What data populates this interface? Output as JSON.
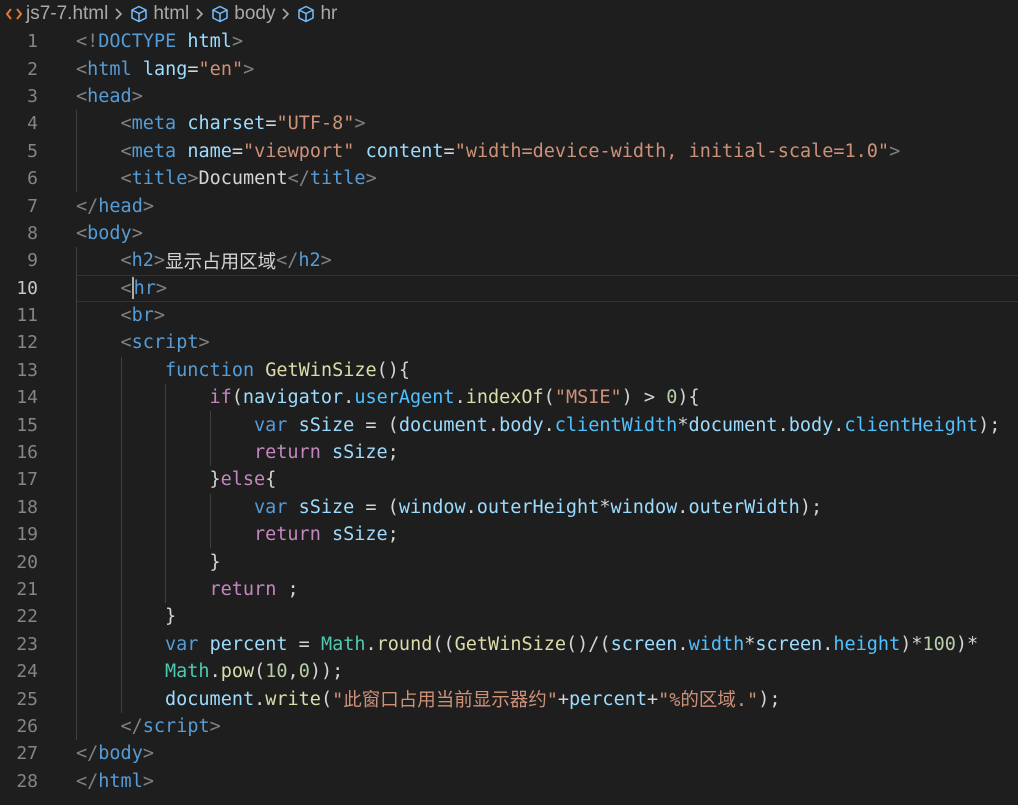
{
  "breadcrumb": {
    "file": "js7-7.html",
    "items": [
      "html",
      "body",
      "hr"
    ]
  },
  "colors": {
    "background": "#1e1e1e",
    "tag": "#569cd6",
    "string": "#ce9178",
    "attribute": "#9cdcfe",
    "function": "#dcdcaa",
    "control": "#c586c0",
    "class": "#4ec9b0",
    "number": "#b5cea8"
  },
  "editor": {
    "current_line": 10,
    "lines": [
      {
        "n": "1",
        "tokens": [
          [
            "p",
            "<!"
          ],
          [
            "t",
            "DOCTYPE"
          ],
          [
            "o",
            " "
          ],
          [
            "a",
            "html"
          ],
          [
            "p",
            ">"
          ]
        ]
      },
      {
        "n": "2",
        "tokens": [
          [
            "p",
            "<"
          ],
          [
            "t",
            "html"
          ],
          [
            "o",
            " "
          ],
          [
            "a",
            "lang"
          ],
          [
            "o",
            "="
          ],
          [
            "s",
            "\"en\""
          ],
          [
            "p",
            ">"
          ]
        ]
      },
      {
        "n": "3",
        "tokens": [
          [
            "p",
            "<"
          ],
          [
            "t",
            "head"
          ],
          [
            "p",
            ">"
          ]
        ]
      },
      {
        "n": "4",
        "indent": 1,
        "tokens": [
          [
            "p",
            "<"
          ],
          [
            "t",
            "meta"
          ],
          [
            "o",
            " "
          ],
          [
            "a",
            "charset"
          ],
          [
            "o",
            "="
          ],
          [
            "s",
            "\"UTF-8\""
          ],
          [
            "p",
            ">"
          ]
        ]
      },
      {
        "n": "5",
        "indent": 1,
        "tokens": [
          [
            "p",
            "<"
          ],
          [
            "t",
            "meta"
          ],
          [
            "o",
            " "
          ],
          [
            "a",
            "name"
          ],
          [
            "o",
            "="
          ],
          [
            "s",
            "\"viewport\""
          ],
          [
            "o",
            " "
          ],
          [
            "a",
            "content"
          ],
          [
            "o",
            "="
          ],
          [
            "s",
            "\"width=device-width, initial-scale=1.0\""
          ],
          [
            "p",
            ">"
          ]
        ]
      },
      {
        "n": "6",
        "indent": 1,
        "tokens": [
          [
            "p",
            "<"
          ],
          [
            "t",
            "title"
          ],
          [
            "p",
            ">"
          ],
          [
            "o",
            "Document"
          ],
          [
            "p",
            "</"
          ],
          [
            "t",
            "title"
          ],
          [
            "p",
            ">"
          ]
        ]
      },
      {
        "n": "7",
        "tokens": [
          [
            "p",
            "</"
          ],
          [
            "t",
            "head"
          ],
          [
            "p",
            ">"
          ]
        ]
      },
      {
        "n": "8",
        "tokens": [
          [
            "p",
            "<"
          ],
          [
            "t",
            "body"
          ],
          [
            "p",
            ">"
          ]
        ]
      },
      {
        "n": "9",
        "indent": 1,
        "tokens": [
          [
            "p",
            "<"
          ],
          [
            "t",
            "h2"
          ],
          [
            "p",
            ">"
          ],
          [
            "o",
            "显示占用区域"
          ],
          [
            "p",
            "</"
          ],
          [
            "t",
            "h2"
          ],
          [
            "p",
            ">"
          ]
        ]
      },
      {
        "n": "10",
        "indent": 1,
        "tokens": [
          [
            "p",
            "<"
          ],
          [
            "cursor",
            ""
          ],
          [
            "t",
            "hr"
          ],
          [
            "p",
            ">"
          ]
        ]
      },
      {
        "n": "11",
        "indent": 1,
        "tokens": [
          [
            "p",
            "<"
          ],
          [
            "t",
            "br"
          ],
          [
            "p",
            ">"
          ]
        ]
      },
      {
        "n": "12",
        "indent": 1,
        "tokens": [
          [
            "p",
            "<"
          ],
          [
            "t",
            "script"
          ],
          [
            "p",
            ">"
          ]
        ]
      },
      {
        "n": "13",
        "indent": 2,
        "tokens": [
          [
            "k",
            "function"
          ],
          [
            "o",
            " "
          ],
          [
            "f",
            "GetWinSize"
          ],
          [
            "o",
            "(){"
          ]
        ]
      },
      {
        "n": "14",
        "indent": 3,
        "tokens": [
          [
            "c",
            "if"
          ],
          [
            "o",
            "("
          ],
          [
            "v",
            "navigator"
          ],
          [
            "o",
            "."
          ],
          [
            "pr",
            "userAgent"
          ],
          [
            "o",
            "."
          ],
          [
            "f",
            "indexOf"
          ],
          [
            "o",
            "("
          ],
          [
            "s",
            "\"MSIE\""
          ],
          [
            "o",
            ") > "
          ],
          [
            "n",
            "0"
          ],
          [
            "o",
            "){"
          ]
        ]
      },
      {
        "n": "15",
        "indent": 4,
        "tokens": [
          [
            "k",
            "var"
          ],
          [
            "o",
            " "
          ],
          [
            "v",
            "sSize"
          ],
          [
            "o",
            " = ("
          ],
          [
            "v",
            "document"
          ],
          [
            "o",
            "."
          ],
          [
            "v",
            "body"
          ],
          [
            "o",
            "."
          ],
          [
            "pr",
            "clientWidth"
          ],
          [
            "o",
            "*"
          ],
          [
            "v",
            "document"
          ],
          [
            "o",
            "."
          ],
          [
            "v",
            "body"
          ],
          [
            "o",
            "."
          ],
          [
            "pr",
            "clientHeight"
          ],
          [
            "o",
            ");"
          ]
        ]
      },
      {
        "n": "16",
        "indent": 4,
        "tokens": [
          [
            "c",
            "return"
          ],
          [
            "o",
            " "
          ],
          [
            "v",
            "sSize"
          ],
          [
            "o",
            ";"
          ]
        ]
      },
      {
        "n": "17",
        "indent": 3,
        "tokens": [
          [
            "o",
            "}"
          ],
          [
            "c",
            "else"
          ],
          [
            "o",
            "{"
          ]
        ]
      },
      {
        "n": "18",
        "indent": 4,
        "tokens": [
          [
            "k",
            "var"
          ],
          [
            "o",
            " "
          ],
          [
            "v",
            "sSize"
          ],
          [
            "o",
            " = ("
          ],
          [
            "v",
            "window"
          ],
          [
            "o",
            "."
          ],
          [
            "v",
            "outerHeight"
          ],
          [
            "o",
            "*"
          ],
          [
            "v",
            "window"
          ],
          [
            "o",
            "."
          ],
          [
            "v",
            "outerWidth"
          ],
          [
            "o",
            ");"
          ]
        ]
      },
      {
        "n": "19",
        "indent": 4,
        "tokens": [
          [
            "c",
            "return"
          ],
          [
            "o",
            " "
          ],
          [
            "v",
            "sSize"
          ],
          [
            "o",
            ";"
          ]
        ]
      },
      {
        "n": "20",
        "indent": 3,
        "tokens": [
          [
            "o",
            "}"
          ]
        ]
      },
      {
        "n": "21",
        "indent": 3,
        "tokens": [
          [
            "c",
            "return"
          ],
          [
            "o",
            " ;"
          ]
        ]
      },
      {
        "n": "22",
        "indent": 2,
        "tokens": [
          [
            "o",
            "}"
          ]
        ]
      },
      {
        "n": "23",
        "indent": 2,
        "tokens": [
          [
            "k",
            "var"
          ],
          [
            "o",
            " "
          ],
          [
            "v",
            "percent"
          ],
          [
            "o",
            " = "
          ],
          [
            "cl",
            "Math"
          ],
          [
            "o",
            "."
          ],
          [
            "f",
            "round"
          ],
          [
            "o",
            "(("
          ],
          [
            "f",
            "GetWinSize"
          ],
          [
            "o",
            "()/("
          ],
          [
            "v",
            "screen"
          ],
          [
            "o",
            "."
          ],
          [
            "pr",
            "width"
          ],
          [
            "o",
            "*"
          ],
          [
            "v",
            "screen"
          ],
          [
            "o",
            "."
          ],
          [
            "pr",
            "height"
          ],
          [
            "o",
            ")*"
          ],
          [
            "n",
            "100"
          ],
          [
            "o",
            ")*"
          ]
        ]
      },
      {
        "n": "24",
        "indent": 2,
        "tokens": [
          [
            "cl",
            "Math"
          ],
          [
            "o",
            "."
          ],
          [
            "f",
            "pow"
          ],
          [
            "o",
            "("
          ],
          [
            "n",
            "10"
          ],
          [
            "o",
            ","
          ],
          [
            "n",
            "0"
          ],
          [
            "o",
            "));"
          ]
        ]
      },
      {
        "n": "25",
        "indent": 2,
        "tokens": [
          [
            "v",
            "document"
          ],
          [
            "o",
            "."
          ],
          [
            "f",
            "write"
          ],
          [
            "o",
            "("
          ],
          [
            "s",
            "\"此窗口占用当前显示器约\""
          ],
          [
            "o",
            "+"
          ],
          [
            "v",
            "percent"
          ],
          [
            "o",
            "+"
          ],
          [
            "s",
            "\"%的区域.\""
          ],
          [
            "o",
            ");"
          ]
        ]
      },
      {
        "n": "26",
        "indent": 1,
        "tokens": [
          [
            "p",
            "</"
          ],
          [
            "t",
            "script"
          ],
          [
            "p",
            ">"
          ]
        ]
      },
      {
        "n": "27",
        "tokens": [
          [
            "p",
            "</"
          ],
          [
            "t",
            "body"
          ],
          [
            "p",
            ">"
          ]
        ]
      },
      {
        "n": "28",
        "tokens": [
          [
            "p",
            "</"
          ],
          [
            "t",
            "html"
          ],
          [
            "p",
            ">"
          ]
        ]
      }
    ]
  }
}
